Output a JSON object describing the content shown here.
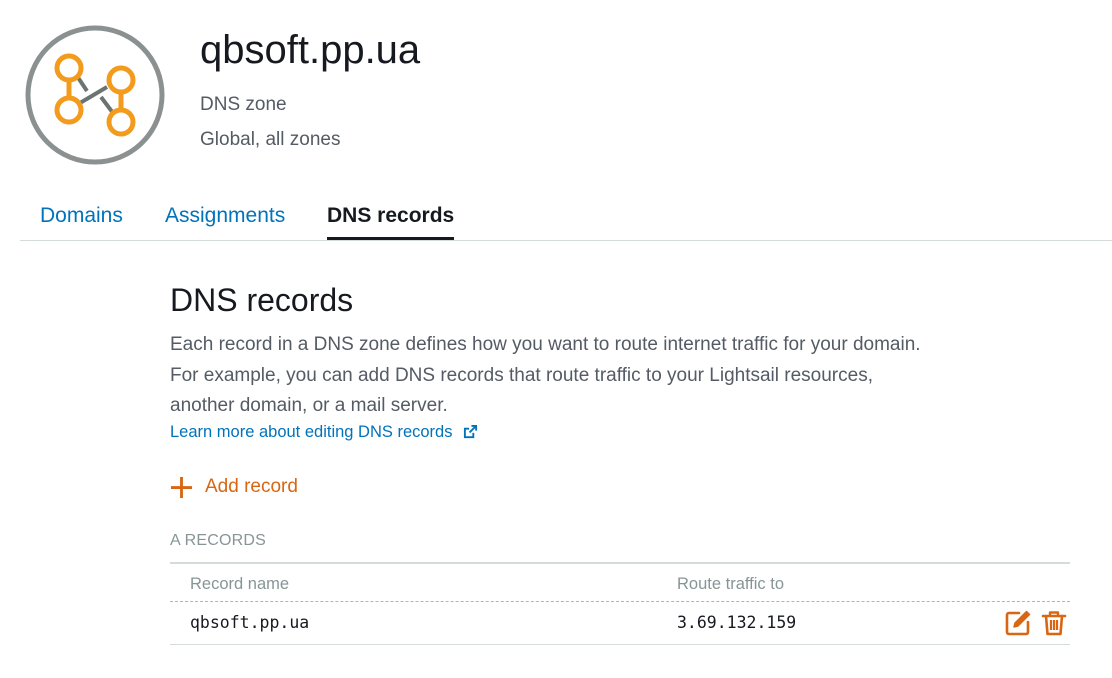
{
  "zone": {
    "name": "qbsoft.pp.ua",
    "type": "DNS zone",
    "region": "Global, all zones",
    "icon": "dns-zone-icon",
    "icon_color": "#f29b1d",
    "icon_ring_color": "#8b9090"
  },
  "tabs": [
    {
      "label": "Domains",
      "active": false
    },
    {
      "label": "Assignments",
      "active": false
    },
    {
      "label": "DNS records",
      "active": true
    }
  ],
  "section": {
    "title": "DNS records",
    "description": "Each record in a DNS zone defines how you want to route internet traffic for your domain. For example, you can add DNS records that route traffic to your Lightsail resources, another domain, or a mail server.",
    "learn_more": "Learn more about editing DNS records",
    "learn_more_icon": "external-link-icon"
  },
  "add_record": {
    "label": "Add record",
    "icon": "plus-icon"
  },
  "a_records": {
    "heading": "A RECORDS",
    "columns": [
      "Record name",
      "Route traffic to"
    ],
    "rows": [
      {
        "name": "qbsoft.pp.ua",
        "target": "3.69.132.159",
        "actions": [
          "edit-icon",
          "trash-icon"
        ]
      }
    ]
  },
  "colors": {
    "accent_orange": "#d86613",
    "link_blue": "#0073bb",
    "text_primary": "#16191f",
    "text_secondary": "#545b64",
    "text_muted": "#879596"
  }
}
